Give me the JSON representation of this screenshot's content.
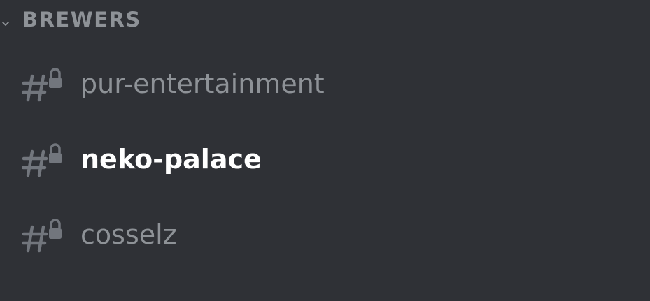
{
  "sidebar": {
    "category": {
      "name": "BREWERS",
      "collapsed": false,
      "chevron_icon": "chevron-down-icon"
    },
    "channels": [
      {
        "name": "pur-entertainment",
        "icon": "locked-text-channel-icon",
        "active": false
      },
      {
        "name": "neko-palace",
        "icon": "locked-text-channel-icon",
        "active": true
      },
      {
        "name": "cosselz",
        "icon": "locked-text-channel-icon",
        "active": false
      }
    ]
  },
  "colors": {
    "background": "#2f3136",
    "muted_text": "#8e9297",
    "active_text": "#ffffff",
    "icon": "#72767d"
  }
}
